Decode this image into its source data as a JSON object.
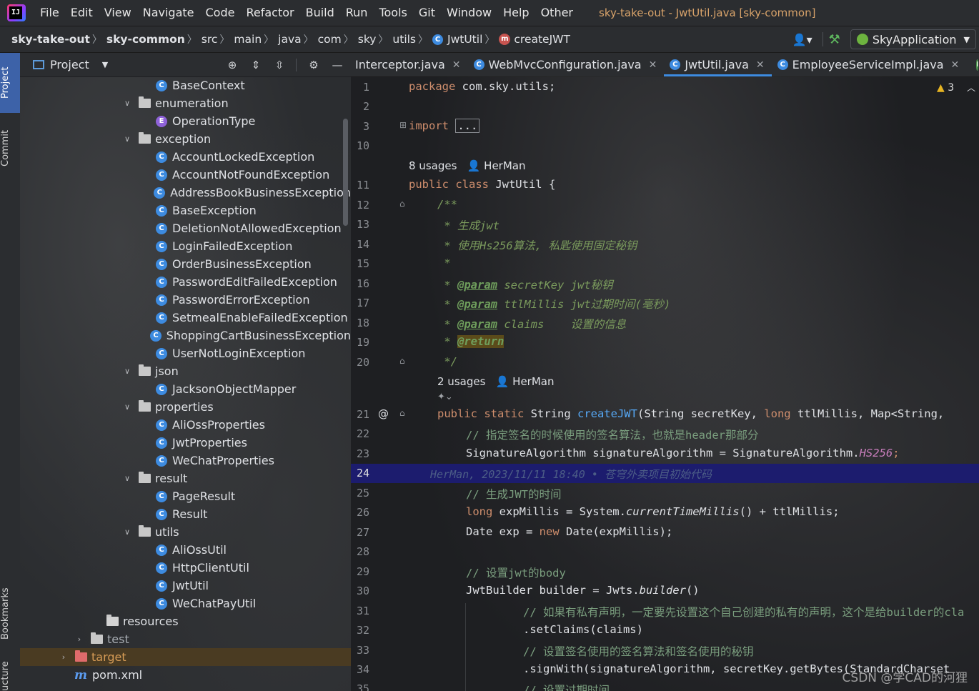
{
  "menubar": {
    "items": [
      "File",
      "Edit",
      "View",
      "Navigate",
      "Code",
      "Refactor",
      "Build",
      "Run",
      "Tools",
      "Git",
      "Window",
      "Help",
      "Other"
    ],
    "window_title": "sky-take-out - JwtUtil.java [sky-common]"
  },
  "breadcrumb": {
    "items": [
      "sky-take-out",
      "sky-common",
      "src",
      "main",
      "java",
      "com",
      "sky",
      "utils",
      "JwtUtil",
      "createJWT"
    ],
    "run_config": "SkyApplication"
  },
  "side_tabs": {
    "project": "Project",
    "commit": "Commit",
    "bookmarks": "Bookmarks",
    "structure": "ucture"
  },
  "project_panel": {
    "title": "Project",
    "tree": [
      {
        "label": "BaseContext",
        "kind": "class",
        "indent": 2
      },
      {
        "label": "enumeration",
        "kind": "folder",
        "indent": 1,
        "open": true
      },
      {
        "label": "OperationType",
        "kind": "enum",
        "indent": 2
      },
      {
        "label": "exception",
        "kind": "folder",
        "indent": 1,
        "open": true
      },
      {
        "label": "AccountLockedException",
        "kind": "class",
        "indent": 2
      },
      {
        "label": "AccountNotFoundException",
        "kind": "class",
        "indent": 2
      },
      {
        "label": "AddressBookBusinessException",
        "kind": "class",
        "indent": 2
      },
      {
        "label": "BaseException",
        "kind": "class",
        "indent": 2
      },
      {
        "label": "DeletionNotAllowedException",
        "kind": "class",
        "indent": 2
      },
      {
        "label": "LoginFailedException",
        "kind": "class",
        "indent": 2
      },
      {
        "label": "OrderBusinessException",
        "kind": "class",
        "indent": 2
      },
      {
        "label": "PasswordEditFailedException",
        "kind": "class",
        "indent": 2
      },
      {
        "label": "PasswordErrorException",
        "kind": "class",
        "indent": 2
      },
      {
        "label": "SetmealEnableFailedException",
        "kind": "class",
        "indent": 2
      },
      {
        "label": "ShoppingCartBusinessException",
        "kind": "class",
        "indent": 2
      },
      {
        "label": "UserNotLoginException",
        "kind": "class",
        "indent": 2
      },
      {
        "label": "json",
        "kind": "folder",
        "indent": 1,
        "open": true
      },
      {
        "label": "JacksonObjectMapper",
        "kind": "class",
        "indent": 2
      },
      {
        "label": "properties",
        "kind": "folder",
        "indent": 1,
        "open": true
      },
      {
        "label": "AliOssProperties",
        "kind": "class",
        "indent": 2
      },
      {
        "label": "JwtProperties",
        "kind": "class",
        "indent": 2
      },
      {
        "label": "WeChatProperties",
        "kind": "class",
        "indent": 2
      },
      {
        "label": "result",
        "kind": "folder",
        "indent": 1,
        "open": true
      },
      {
        "label": "PageResult",
        "kind": "class",
        "indent": 2
      },
      {
        "label": "Result",
        "kind": "class",
        "indent": 2
      },
      {
        "label": "utils",
        "kind": "folder",
        "indent": 1,
        "open": true
      },
      {
        "label": "AliOssUtil",
        "kind": "class",
        "indent": 2
      },
      {
        "label": "HttpClientUtil",
        "kind": "class",
        "indent": 2
      },
      {
        "label": "JwtUtil",
        "kind": "class",
        "indent": 2
      },
      {
        "label": "WeChatPayUtil",
        "kind": "class",
        "indent": 2
      },
      {
        "label": "resources",
        "kind": "resfolder",
        "indent": 0
      },
      {
        "label": "test",
        "kind": "folder",
        "indent": -1,
        "open": false
      },
      {
        "label": "target",
        "kind": "redfolder",
        "indent": -2,
        "open": false,
        "selected": true
      },
      {
        "label": "pom.xml",
        "kind": "maven",
        "indent": -2
      }
    ]
  },
  "editor": {
    "tabs": [
      {
        "label": "Interceptor.java",
        "active": false
      },
      {
        "label": "WebMvcConfiguration.java",
        "active": false
      },
      {
        "label": "JwtUtil.java",
        "active": true
      },
      {
        "label": "EmployeeServiceImpl.java",
        "active": false
      }
    ],
    "warnings": "3",
    "usages_class": "8 usages",
    "usages_method": "2 usages",
    "author": "HerMan",
    "blame_line": "HerMan, 2023/11/11 18:40 • 苍穹外卖项目初始代码",
    "line_numbers": [
      "1",
      "2",
      "3",
      "10",
      "11",
      "12",
      "13",
      "14",
      "15",
      "16",
      "17",
      "18",
      "19",
      "20",
      "21",
      "22",
      "23",
      "24",
      "25",
      "26",
      "27",
      "28",
      "29",
      "30",
      "31",
      "32",
      "33",
      "34",
      "35"
    ],
    "code": {
      "l1_kw": "package",
      "l1_pkg": " com.sky.utils;",
      "l3_kw": "import",
      "l3_fold": "...",
      "l11_kw": "public class",
      "l11_rest": " JwtUtil {",
      "l12": "/**",
      "l13": " * 生成jwt",
      "l14": " * 使用Hs256算法, 私匙使用固定秘钥",
      "l15": " *",
      "l16_tag": "@param",
      "l16_rest": " secretKey jwt秘钥",
      "l17_tag": "@param",
      "l17_rest": " ttlMillis jwt过期时间(毫秒)",
      "l18_tag": "@param",
      "l18_rest": " claims    设置的信息",
      "l19_tag": "@return",
      "l20": " */",
      "l21_kw": "public static",
      "l21_type": " String ",
      "l21_fn": "createJWT",
      "l21_rest": "(String secretKey, ",
      "l21_kw2": "long",
      "l21_rest2": " ttlMillis, Map<String,",
      "l22": "// 指定签名的时候使用的签名算法，也就是header那部分",
      "l23_a": "SignatureAlgorithm signatureAlgorithm = SignatureAlgorithm.",
      "l23_b": "HS256",
      "l23_c": ";",
      "l25": "// 生成JWT的时间",
      "l26_kw": "long",
      "l26_a": " expMillis = System.",
      "l26_b": "currentTimeMillis",
      "l26_c": "() + ttlMillis;",
      "l27_a": "Date exp = ",
      "l27_kw": "new",
      "l27_b": " Date(expMillis);",
      "l29": "// 设置jwt的body",
      "l30_a": "JwtBuilder builder = Jwts.",
      "l30_b": "builder",
      "l30_c": "()",
      "l31": "// 如果有私有声明，一定要先设置这个自己创建的私有的声明，这个是给builder的cla",
      "l32": ".setClaims(claims)",
      "l33": "// 设置签名使用的签名算法和签名使用的秘钥",
      "l34": ".signWith(signatureAlgorithm, secretKey.getBytes(StandardCharset",
      "l35": "// 设置过期时间"
    }
  },
  "watermark": "CSDN @学CAD的河狸"
}
